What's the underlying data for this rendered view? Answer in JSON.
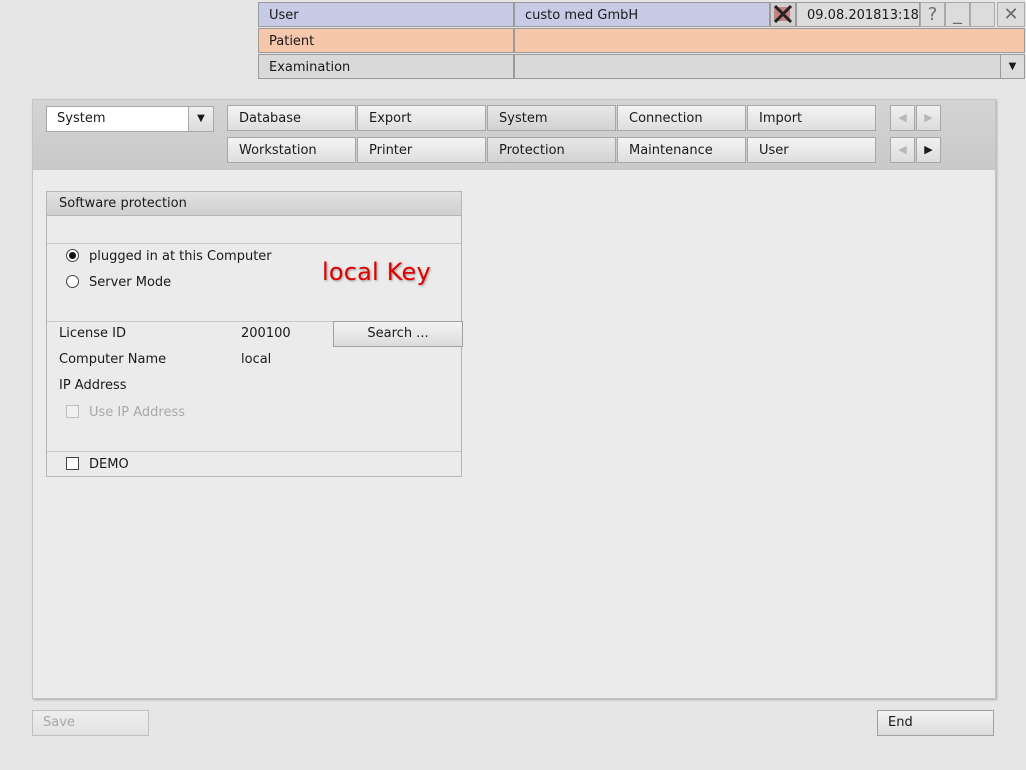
{
  "header": {
    "user_label": "User",
    "company": "custo med GmbH",
    "datetime": "09.08.201813:18",
    "help": "?",
    "minimize": "_",
    "close": "✕",
    "patient_label": "Patient",
    "patient_value": "",
    "examination_label": "Examination",
    "examination_value": "",
    "dropdown_arrow": "▼"
  },
  "toolbar": {
    "category_select": "System",
    "tabs_row1": [
      "Database",
      "Export",
      "System",
      "Connection",
      "Import"
    ],
    "tabs_row2": [
      "Workstation",
      "Printer",
      "Protection",
      "Maintenance",
      "User"
    ],
    "active_row1": "System",
    "active_row2": "Protection"
  },
  "protection": {
    "title": "Software protection",
    "radio_local": "plugged in at this Computer",
    "radio_server": "Server Mode",
    "radio_selected": "plugged in at this Computer",
    "license_id_label": "License ID",
    "license_id_value": "200100",
    "search_button": "Search ...",
    "computer_name_label": "Computer Name",
    "computer_name_value": "local",
    "ip_address_label": "IP Address",
    "use_ip_label": "Use IP Address",
    "demo_label": "DEMO"
  },
  "annotation": "local Key",
  "footer": {
    "save": "Save",
    "end": "End"
  },
  "colors": {
    "user_row": "#c7cbe6",
    "patient_row": "#f6c7aa",
    "annotation": "#e00000"
  }
}
